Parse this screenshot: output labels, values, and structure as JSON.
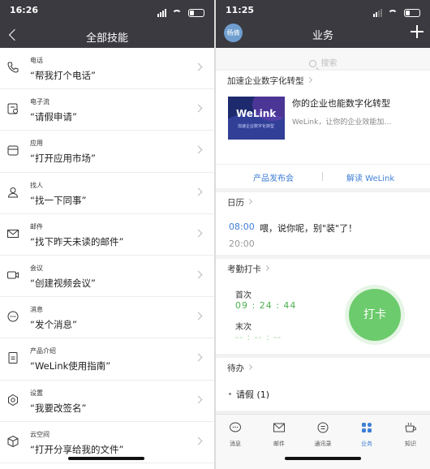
{
  "left": {
    "status": {
      "time": "16:26"
    },
    "header": {
      "title": "全部技能"
    },
    "skills": [
      {
        "category": "电话",
        "command": "“帮我打个电话”",
        "icon": "phone-icon"
      },
      {
        "category": "电子流",
        "command": "“请假申请”",
        "icon": "e-flow-icon"
      },
      {
        "category": "应用",
        "command": "“打开应用市场”",
        "icon": "app-store-icon"
      },
      {
        "category": "找人",
        "command": "“找一下同事”",
        "icon": "person-icon"
      },
      {
        "category": "邮件",
        "command": "“找下昨天未读的邮件”",
        "icon": "mail-icon"
      },
      {
        "category": "会议",
        "command": "“创建视频会议”",
        "icon": "video-icon"
      },
      {
        "category": "消息",
        "command": "“发个消息”",
        "icon": "message-icon"
      },
      {
        "category": "产品介绍",
        "command": "“WeLink使用指南”",
        "icon": "product-icon"
      },
      {
        "category": "设置",
        "command": "“我要改签名”",
        "icon": "settings-icon"
      },
      {
        "category": "云空间",
        "command": "“打开分享给我的文件”",
        "icon": "cloud-space-icon"
      }
    ]
  },
  "right": {
    "status": {
      "time": "11:25"
    },
    "header": {
      "title": "业务",
      "avatar_text": "杨倩"
    },
    "search": {
      "placeholder": "搜索"
    },
    "news": {
      "heading": "加速企业数字化转型",
      "banner_logo": "WeLink",
      "banner_sub": "加速企业数字化转型",
      "title": "你的企业也能数字化转型",
      "desc": "WeLink，让你的企业效能加…",
      "link_left": "产品发布会",
      "link_right": "解读 WeLink"
    },
    "calendar": {
      "heading": "日历",
      "time": "08:00",
      "text": "喂，说你呢，别\"装\"了！",
      "time2": "20:00"
    },
    "attendance": {
      "heading": "考勤打卡",
      "first_label": "首次",
      "first_time": "09 : 24 : 44",
      "last_label": "末次",
      "last_time": "-- : -- : --",
      "button": "打卡"
    },
    "todo": {
      "heading": "待办",
      "item": "请假 (1)"
    },
    "tabs": [
      {
        "label": "消息",
        "icon": "chat-bubble-icon"
      },
      {
        "label": "邮件",
        "icon": "mail-icon"
      },
      {
        "label": "通讯录",
        "icon": "contacts-icon"
      },
      {
        "label": "业务",
        "icon": "grid-icon",
        "active": true
      },
      {
        "label": "知识",
        "icon": "coffee-cup-icon"
      }
    ]
  },
  "colors": {
    "header_bg": "#3a3a40",
    "accent_blue": "#3f7fd6",
    "punch_green": "#6ccb6c"
  }
}
